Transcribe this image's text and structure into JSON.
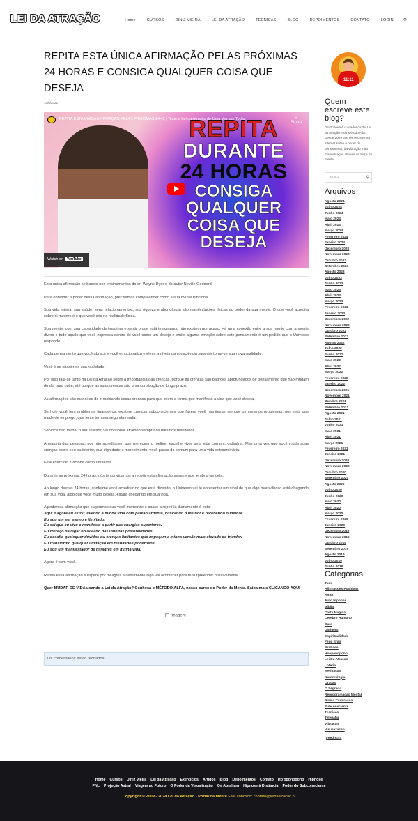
{
  "header": {
    "logo": "LEI DA ATRAÇÃO",
    "nav": [
      "Home",
      "CURSOS",
      "DINIZ VIEIRA",
      "LEI DA ATRAÇÃO",
      "TECNICAS",
      "BLOG",
      "DEPOIMENTOS",
      "CONTATO",
      "LOGIN"
    ]
  },
  "post": {
    "title": "REPITA ESTA ÚNICA AFIRMAÇÃO PELAS PRÓXIMAS 24 HORAS E CONSIGA QUALQUER COISA QUE DESEJA",
    "date": "10/6/2022",
    "video": {
      "title": "REPITA ESTA ÚNICA AFIRMAÇÃO PELAS PRÓXIMAS 24HS | Teste a Lei da Atração de Uma Vez por Todas",
      "share": "Share",
      "big_text": [
        "REPITA",
        "DURANTE",
        "24 HORAS",
        "CONSIGA",
        "QUALQUER",
        "COISA QUE",
        "DESEJA"
      ],
      "watch_on": "Watch on",
      "youtube": "YouTube"
    },
    "paragraphs": [
      "Esta única afirmação se baseia nos ensinamentos do dr. Wayne Dyer e do autor Neville Goddard.",
      "Para entender o poder dessa afirmação, precisamos compreender como a sua mente funciona.",
      "Sua vida inteira, sua saúde, seus relacionamentos, sua riqueza e abundância são manifestações físicas do poder da sua mente. O que você acredita sobre si mesmo é o que você cria na realidade física.",
      "Sua mente, com sua capacidade de imaginar e sentir o que está imaginando não existem por acaso. Há uma conexão entre a sua mente com a mente divina e tudo aquilo que você expressa dentro de você como um desejo e emite alguma emoção sobre este pensamento é um pedido que o Universo responde.",
      "Cada pensamento que você abraça e você emocionaliza e eleva a níveis da consciência superior torna-se sua nova realidade.",
      "Você é co-criador de sua realidade.",
      "Por isso fala-se tanto na Lei da Atração sobre a importância das crenças, porque as crenças são padrões aprofundados de pensamento que não mudam do dia para noite, até porque as suas crenças são uma construção de longo prazo.",
      "As afirmações são maneiras de ir moldando essas crenças para que criem a forma que manifesta a vida que você deseja.",
      "Se hoje você tem problemas financeiros, existem crenças subconscientes que fazem você manifestar sempre os mesmos problemas, por mais que mude de emprego, que tente ter uma segunda renda.",
      "Se você não mudar o seu interior, vai continuar atraindo sempre os mesmos resultados.",
      "A maioria das pessoas, por não acreditarem que merecem o melhor, escolhe viver uma vida comum, ordinária. Mas uma vez que você muda suas crenças sobre seu eu interior, sua dignidade e merecimento, você passa do comum para uma vida extraordinária.",
      "Este exercício funciona como um teste.",
      "Durante as próximas 24 horas, nós te convidamos a repetir esta afirmação sempre que lembrar-se dela.",
      "Ao longo dessas 24 horas, conforme você acreditar no que está dizendo, o Universo vai te apresentar um sinal de que algo maravilhoso está chegando em sua vida, algo que você muito deseja, estará chegando em sua vida."
    ],
    "intro_aff": "A poderosa afirmação que sugerimos que você memorize e passe a repeti-la diariamente é esta:",
    "affirmations": [
      "Aqui e agora eu estou vivendo a minha vida com paixão ardente, buscando o melhor e recebendo o melhor.",
      "Eu sou um ser eterno e ilimitado.",
      "Eu sei que eu vivo e manifesto a partir das energias superiores.",
      "Eu mereço navegar no oceano das infinitas possibilidades.",
      "Eu desafio quaisquer dúvidas ou crenças limitantes que impeçam a minha versão mais elevada de triunfar.",
      "Eu transformo qualquer limitação em resultados poderosos.",
      "Eu sou um manifestador de milagres em minha vida."
    ],
    "after": [
      "Agora é com você.",
      "Repita essa afirmação e espere por milagres e certamente algo vai acontecer para te surpreender positivamente."
    ],
    "cta_text": "Quer MUDAR DE VIDA usando a Lei da Atração? Conheça o MÉTODO ALFA, nosso curso do Poder da Mente. Saiba mais ",
    "cta_link": "CLICANDO AQUI",
    "image_alt": "Imagem",
    "comments_closed": "Os comentários estão fechados."
  },
  "sidebar": {
    "avatar_text": "11:11",
    "about_title": "Quem escreve este blog?",
    "about_text": "Diniz Vieira é o criador da TV Lei da Atração e do Método Alfa. Desde 2009 que ele escreve na internet sobre o poder do pensamento, da vibração e da manifestação através da força da mente.",
    "search_placeholder": "Busca",
    "archives_title": "Arquivos",
    "archives": [
      "Agosto 2024",
      "Julho 2024",
      "Junho 2024",
      "Maio 2024",
      "Abril 2024",
      "Março 2024",
      "Fevereiro 2024",
      "Janeiro 2024",
      "Dezembro 2023",
      "Novembro 2023",
      "Outubro 2023",
      "Setembro 2023",
      "Agosto 2023",
      "Julho 2023",
      "Junho 2023",
      "Maio 2023",
      "Abril 2023",
      "Março 2023",
      "Fevereiro 2023",
      "Janeiro 2023",
      "Dezembro 2022",
      "Novembro 2022",
      "Outubro 2022",
      "Setembro 2022",
      "Agosto 2022",
      "Julho 2022",
      "Junho 2022",
      "Maio 2022",
      "Abril 2022",
      "Março 2022",
      "Fevereiro 2022",
      "Janeiro 2022",
      "Dezembro 2021",
      "Novembro 2021",
      "Outubro 2021",
      "Setembro 2021",
      "Agosto 2021",
      "Julho 2021",
      "Junho 2021",
      "Maio 2021",
      "Abril 2021",
      "Março 2021",
      "Fevereiro 2021",
      "Janeiro 2021",
      "Dezembro 2020",
      "Novembro 2020",
      "Outubro 2020",
      "Setembro 2020",
      "Agosto 2020",
      "Julho 2020",
      "Junho 2020",
      "Maio 2020",
      "Abril 2020",
      "Março 2020",
      "Fevereiro 2020",
      "Janeiro 2020",
      "Dezembro 2019",
      "Novembro 2019",
      "Outubro 2019",
      "Setembro 2019",
      "Agosto 2019",
      "Julho 2019",
      "Junho 2019"
    ],
    "categories_title": "Categorias",
    "categories": [
      "Tudo",
      "Afirmacoes Positivas",
      "Amor",
      "Auto Hipnose",
      "Bíblia",
      "Carta Magica",
      "Cerebro Humano",
      "Cura",
      "Dinheiro",
      "Espiritualidade",
      "Feng Shui",
      "Gratidao",
      "Hooponopono",
      "Lei Da Atracao",
      "Loteria",
      "Meditacao",
      "Numerologia",
      "Oracao",
      "O Segredo",
      "Reprogramacao Mental",
      "Sinais Poderosos",
      "Subconsciente",
      "Tecnicas",
      "Telepatia",
      "Vibracao",
      "Visualizacao"
    ],
    "feed": "Feed RSS"
  },
  "footer": {
    "nav_row1": [
      "Home",
      "Cursos",
      "Diniz Vieira",
      "Lei da Atração",
      "Exercícios",
      "Artigos",
      "Blog",
      "Depoimentos",
      "Contato",
      "Ho'oponopono",
      "Hipnose"
    ],
    "nav_row2": [
      "PNL",
      "Projeção Astral",
      "Viagem ao Futuro",
      "O Poder da Visualização",
      "Os Abraham",
      "Hipnose à Distância",
      "Poder do Subconsciente"
    ],
    "copyright": "Copyright © 2009 - 2024 Lei da Atração - Portal da Mente",
    "contact": " Fale conosco: contato@leidaatracao.tv"
  }
}
